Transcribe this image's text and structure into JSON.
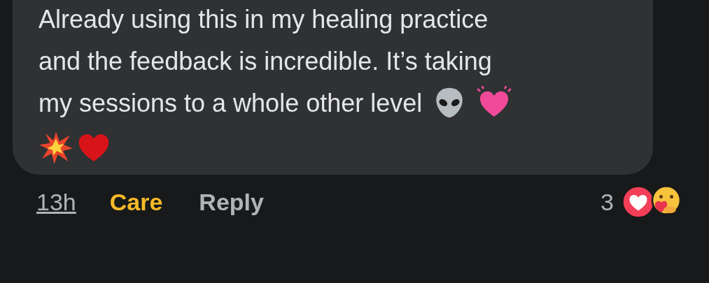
{
  "comment": {
    "lines": [
      "Already using this in my healing practice",
      "and the feedback is incredible. It’s taking",
      "my sessions to a whole other level"
    ]
  },
  "footer": {
    "time": "13h",
    "reaction_button": "Care",
    "reply": "Reply",
    "reaction_count": "3"
  }
}
